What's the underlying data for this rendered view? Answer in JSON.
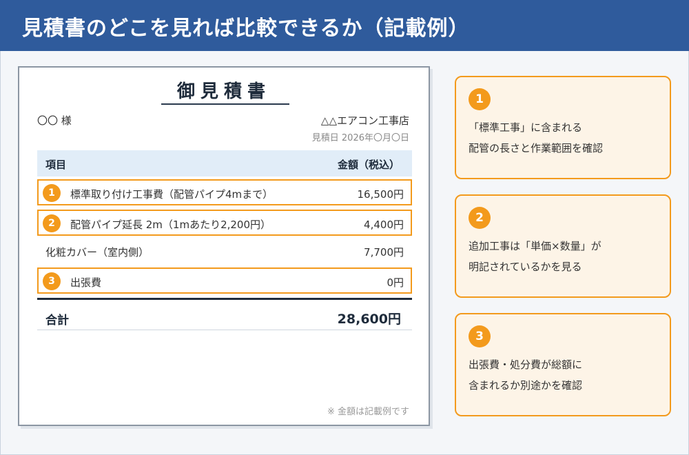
{
  "header": {
    "title": "見積書のどこを見れば比較できるか（記載例）"
  },
  "document": {
    "title": "御見積書",
    "recipient": "〇〇 様",
    "vendor": "△△エアコン工事店",
    "date": "見積日 2026年〇月〇日",
    "table_header": {
      "item": "項目",
      "amount": "金額（税込）"
    },
    "rows": [
      {
        "badge": "1",
        "label": "標準取り付け工事費（配管パイプ4mまで）",
        "amount": "16,500円"
      },
      {
        "badge": "2",
        "label": "配管パイプ延長 2m（1mあたり2,200円）",
        "amount": "4,400円"
      },
      {
        "badge": "",
        "label": "化粧カバー（室内側）",
        "amount": "7,700円"
      },
      {
        "badge": "3",
        "label": "出張費",
        "amount": "0円"
      }
    ],
    "total": {
      "label": "合計",
      "amount": "28,600円"
    },
    "note": "※ 金額は記載例です"
  },
  "cards": [
    {
      "badge": "1",
      "line1": "「標準工事」に含まれる",
      "line2": "配管の長さと作業範囲を確認"
    },
    {
      "badge": "2",
      "line1": "追加工事は「単価×数量」が",
      "line2": "明記されているかを見る"
    },
    {
      "badge": "3",
      "line1": "出張費・処分費が総額に",
      "line2": "含まれるか別途かを確認"
    }
  ],
  "colors": {
    "header": "#2f5b9c",
    "accent": "#f39a1c",
    "card_bg": "#fdf4e7",
    "table_header_bg": "#e1edf8"
  }
}
